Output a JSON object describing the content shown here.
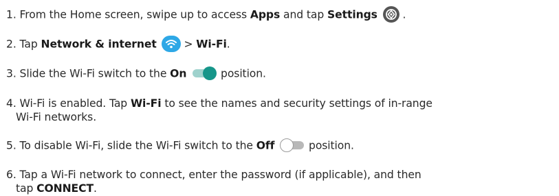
{
  "steps": [
    {
      "n": "1.",
      "a": "From the Home screen, swipe up to access ",
      "b1": "Apps",
      "a2": " and tap ",
      "b2": "Settings",
      "a3": " ."
    },
    {
      "n": "2.",
      "a": "Tap ",
      "b1": "Network & internet",
      "a2": " > ",
      "b2": "Wi-Fi",
      "a3": "."
    },
    {
      "n": "3.",
      "a": "Slide the Wi-Fi switch to the ",
      "b1": "On",
      "a2": " position."
    },
    {
      "n": "4.",
      "a": "Wi-Fi is enabled. Tap ",
      "b1": "Wi-Fi",
      "a2": " to see the names and security settings of in-range",
      "a3": "Wi-Fi networks."
    },
    {
      "n": "5.",
      "a": "To disable Wi-Fi, slide the Wi-Fi switch to the ",
      "b1": "Off",
      "a2": " position."
    },
    {
      "n": "6.",
      "a": "Tap a Wi-Fi network to connect, enter the password (if applicable), and then",
      "a2": "tap ",
      "b1": "CONNECT",
      "a3": "."
    }
  ],
  "icons": {
    "settings": "settings-gear-icon",
    "wifi": "wifi-icon",
    "toggle_on": "toggle-on-icon",
    "toggle_off": "toggle-off-icon"
  },
  "colors": {
    "teal": "#16968a",
    "teal_light": "#9fd2cd",
    "wifi_blue": "#2ea8e6",
    "gray": "#555555",
    "track_off": "#b8b8b8"
  }
}
